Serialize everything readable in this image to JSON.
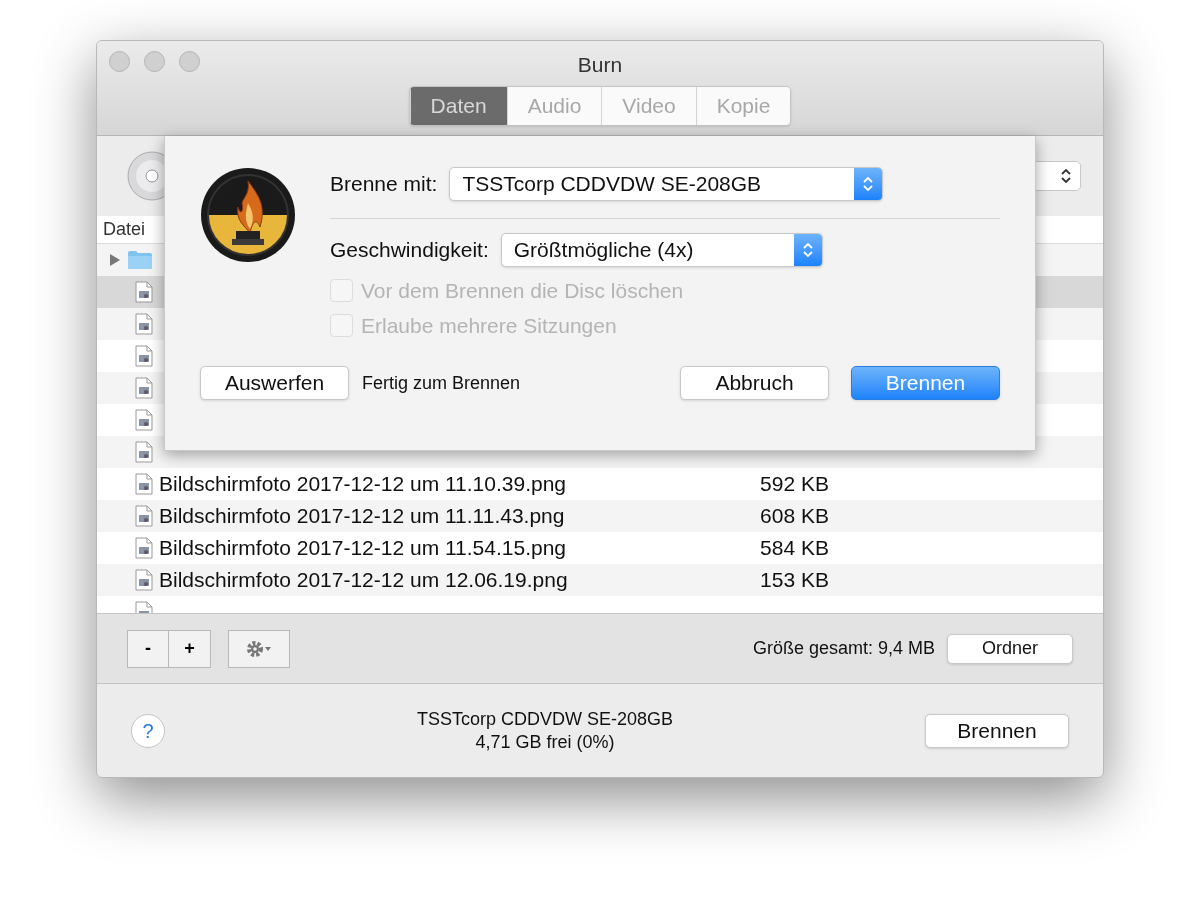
{
  "window": {
    "title": "Burn"
  },
  "tabs": [
    {
      "label": "Daten",
      "selected": true
    },
    {
      "label": "Audio",
      "selected": false
    },
    {
      "label": "Video",
      "selected": false
    },
    {
      "label": "Kopie",
      "selected": false
    }
  ],
  "table": {
    "columns": [
      "Datei"
    ],
    "rows": [
      {
        "kind": "folder",
        "selected": false
      },
      {
        "kind": "file",
        "selected": true
      },
      {
        "kind": "file",
        "selected": false
      },
      {
        "kind": "file",
        "selected": false
      },
      {
        "kind": "file",
        "selected": false
      },
      {
        "kind": "file",
        "selected": false
      },
      {
        "kind": "file",
        "selected": false
      },
      {
        "kind": "file",
        "name": "Bildschirmfoto 2017-12-12 um 11.10.39.png",
        "size": "592 KB",
        "selected": false
      },
      {
        "kind": "file",
        "name": "Bildschirmfoto 2017-12-12 um 11.11.43.png",
        "size": "608 KB",
        "selected": false
      },
      {
        "kind": "file",
        "name": "Bildschirmfoto 2017-12-12 um 11.54.15.png",
        "size": "584 KB",
        "selected": false
      },
      {
        "kind": "file",
        "name": "Bildschirmfoto 2017-12-12 um 12.06.19.png",
        "size": "153 KB",
        "selected": false
      },
      {
        "kind": "file",
        "selected": false
      }
    ]
  },
  "sheet": {
    "burner_label": "Brenne mit:",
    "burner": "TSSTcorp CDDVDW SE-208GB",
    "speed_label": "Geschwindigkeit:",
    "speed": "Größtmögliche (4x)",
    "options": [
      {
        "label": "Vor dem Brennen die Disc löschen",
        "checked": false,
        "disabled": true
      },
      {
        "label": "Erlaube mehrere Sitzungen",
        "checked": false,
        "disabled": true
      }
    ],
    "eject_button": "Auswerfen",
    "status": "Fertig zum Brennen",
    "cancel_button": "Abbruch",
    "burn_button": "Brennen"
  },
  "bottom_bar": {
    "remove_button": "-",
    "add_button": "+",
    "total_size": "Größe gesamt: 9,4 MB",
    "folder_button": "Ordner"
  },
  "footer": {
    "help_button": "?",
    "drive": "TSSTcorp CDDVDW SE-208GB",
    "free_space": "4,71 GB frei (0%)",
    "burn_button": "Brennen"
  }
}
